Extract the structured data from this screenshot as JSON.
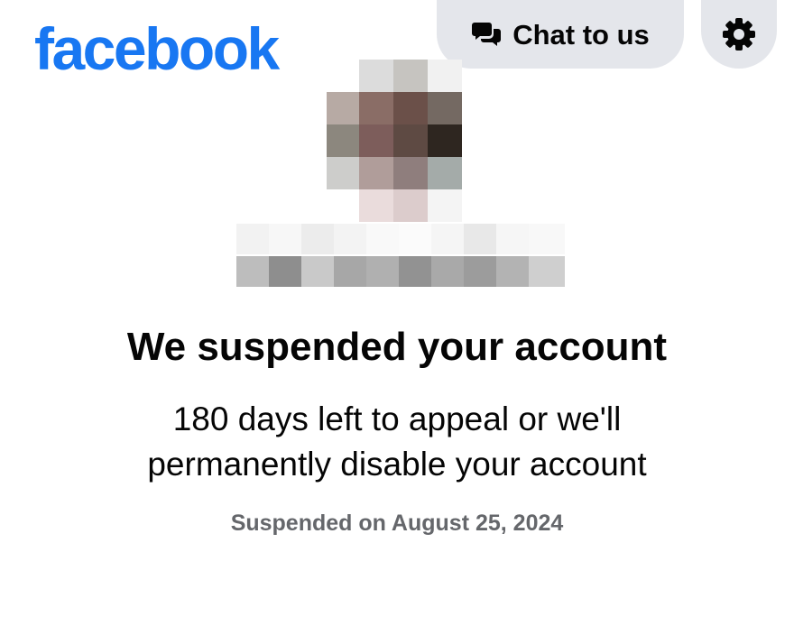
{
  "header": {
    "logo_text": "facebook",
    "brand_color": "#1877f2",
    "chat_button": {
      "label": "Chat to us",
      "icon": "chat-bubbles-icon"
    },
    "settings_button": {
      "icon": "gear-icon"
    }
  },
  "profile": {
    "avatar_icon": "pixelated-avatar",
    "name_redacted": true
  },
  "notice": {
    "headline": "We suspended your account",
    "body_line1": "180 days left to appeal or we'll",
    "body_line2": "permanently disable your account",
    "suspended_on": "Suspended on August 25, 2024"
  },
  "colors": {
    "text_primary": "#050505",
    "text_secondary": "#65676b",
    "button_bg": "#e4e6eb"
  }
}
